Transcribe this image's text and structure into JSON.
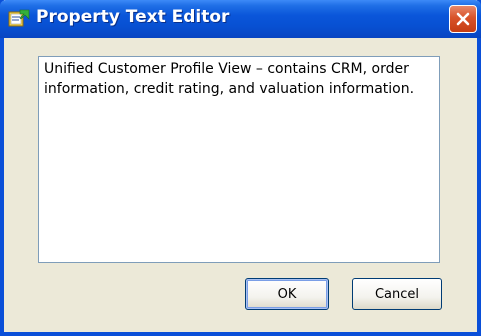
{
  "window": {
    "title": "Property Text Editor",
    "title_icon": "property-editor-icon",
    "close_icon": "close-icon"
  },
  "editor": {
    "value": "Unified Customer Profile View – contains CRM, order information, credit rating, and valuation information."
  },
  "buttons": {
    "ok_label": "OK",
    "cancel_label": "Cancel"
  },
  "colors": {
    "titlebar": "#0a56da",
    "close_button": "#d8532a",
    "dialog_background": "#ece9d8",
    "textarea_border": "#7f9db9"
  }
}
